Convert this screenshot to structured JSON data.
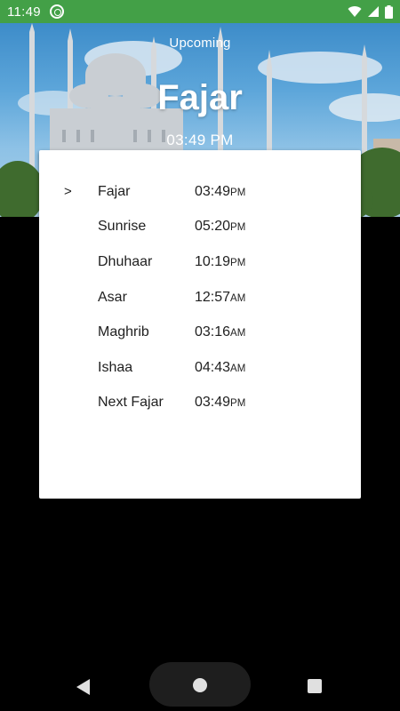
{
  "status_bar": {
    "time": "11:49",
    "icons": [
      "at-sign-notification-icon",
      "wifi-icon",
      "signal-icon",
      "battery-icon"
    ]
  },
  "hero": {
    "label": "Upcoming",
    "prayer_name": "Fajar",
    "prayer_time": "03:49 PM"
  },
  "prayers": [
    {
      "marker": ">",
      "name": "Fajar",
      "time": "03:49",
      "suffix": "PM"
    },
    {
      "marker": "",
      "name": "Sunrise",
      "time": "05:20",
      "suffix": "PM"
    },
    {
      "marker": "",
      "name": "Dhuhaar",
      "time": "10:19",
      "suffix": "PM"
    },
    {
      "marker": "",
      "name": "Asar",
      "time": "12:57",
      "suffix": "AM"
    },
    {
      "marker": "",
      "name": "Maghrib",
      "time": "03:16",
      "suffix": "AM"
    },
    {
      "marker": "",
      "name": "Ishaa",
      "time": "04:43",
      "suffix": "AM"
    },
    {
      "marker": "",
      "name": "Next Fajar",
      "time": "03:49",
      "suffix": "PM"
    }
  ],
  "colors": {
    "status_bar": "#43a047",
    "card": "#ffffff",
    "background": "#000000"
  }
}
